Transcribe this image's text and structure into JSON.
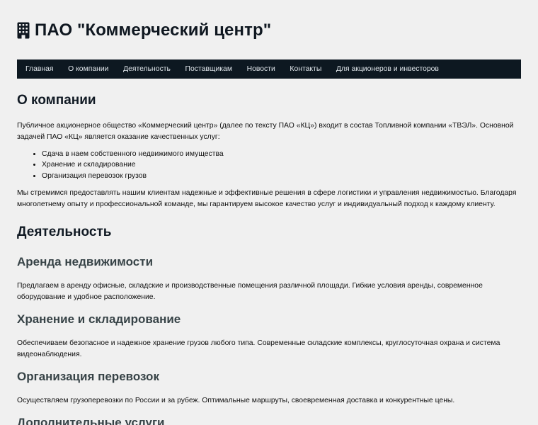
{
  "site": {
    "title": "ПАО \"Коммерческий центр\"",
    "icon": "building-icon"
  },
  "nav": {
    "items": [
      "Главная",
      "О компании",
      "Деятельность",
      "Поставщикам",
      "Новости",
      "Контакты",
      "Для акционеров и инвесторов"
    ]
  },
  "about": {
    "title": "О компании",
    "intro": "Публичное акционерное общество «Коммерческий центр» (далее по тексту ПАО «КЦ») входит в состав Топливной компании «ТВЭЛ». Основной задачей ПАО «КЦ» является оказание качественных услуг:",
    "list": [
      "Сдача в наем собственного недвижимого имущества",
      "Хранение и складирование",
      "Организация перевозок грузов"
    ],
    "outro": "Мы стремимся предоставлять нашим клиентам надежные и эффективные решения в сфере логистики и управления недвижимостью. Благодаря многолетнему опыту и профессиональной команде, мы гарантируем высокое качество услуг и индивидуальный подход к каждому клиенту."
  },
  "activity": {
    "title": "Деятельность",
    "services": [
      {
        "title": "Аренда недвижимости",
        "text": "Предлагаем в аренду офисные, складские и производственные помещения различной площади. Гибкие условия аренды, современное оборудование и удобное расположение."
      },
      {
        "title": "Хранение и складирование",
        "text": "Обеспечиваем безопасное и надежное хранение грузов любого типа. Современные складские комплексы, круглосуточная охрана и система видеонаблюдения."
      },
      {
        "title": "Организация перевозок",
        "text": "Осуществляем грузоперевозки по России и за рубеж. Оптимальные маршруты, своевременная доставка и конкурентные цены."
      },
      {
        "title": "Дополнительные услуги",
        "text": ""
      }
    ]
  }
}
